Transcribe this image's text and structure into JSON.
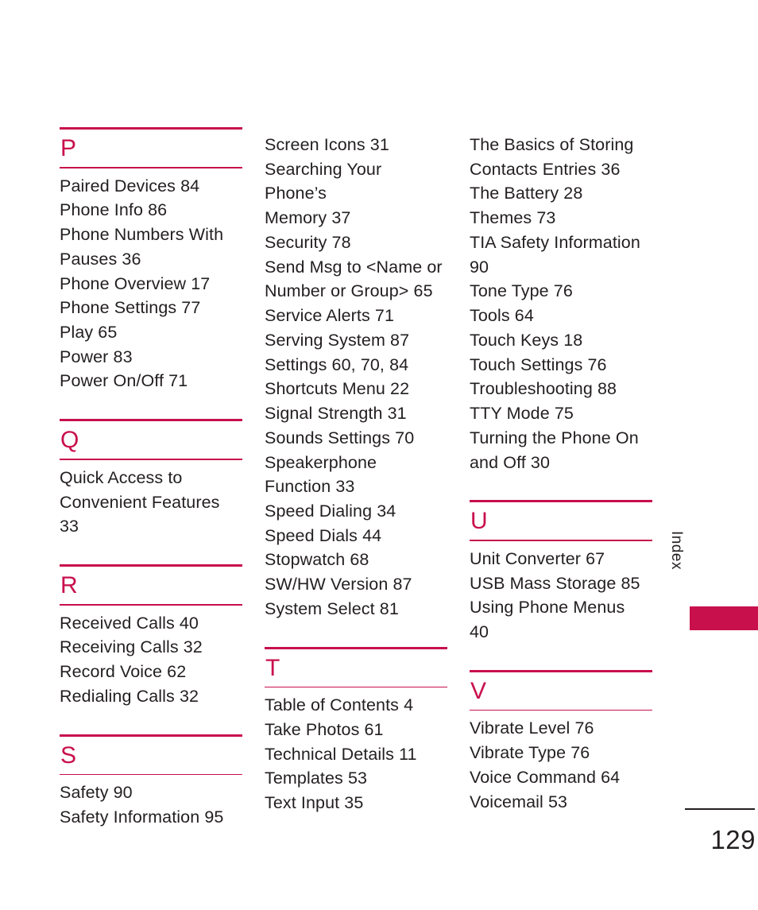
{
  "document": {
    "kind": "printed-manual-index-page",
    "page_number": "129",
    "side_tab_label": "Index",
    "accent_color": "#c8104c",
    "text_color": "#231f20",
    "background_color": "#ffffff"
  },
  "columns": [
    {
      "id": "column-1",
      "sections": [
        {
          "letter": "P",
          "has_heading": true,
          "entries": [
            "Paired Devices 84",
            "Phone Info 86",
            "Phone Numbers With\nPauses 36",
            "Phone Overview 17",
            "Phone Settings 77",
            "Play 65",
            "Power 83",
            "Power On/Off 71"
          ]
        },
        {
          "letter": "Q",
          "has_heading": true,
          "entries": [
            "Quick Access to\nConvenient Features\n33"
          ]
        },
        {
          "letter": "R",
          "has_heading": true,
          "entries": [
            "Received Calls 40",
            "Receiving Calls 32",
            "Record Voice 62",
            "Redialing Calls 32"
          ]
        },
        {
          "letter": "S",
          "has_heading": true,
          "entries": [
            "Safety 90",
            "Safety Information 95"
          ]
        }
      ]
    },
    {
      "id": "column-2",
      "sections": [
        {
          "letter": "",
          "has_heading": false,
          "entries": [
            "Screen Icons 31",
            "Searching Your Phone’s\nMemory 37",
            "Security 78",
            "Send Msg to <Name or\nNumber or Group> 65",
            "Service Alerts 71",
            "Serving System 87",
            "Settings 60, 70, 84",
            "Shortcuts Menu 22",
            "Signal Strength 31",
            "Sounds Settings 70",
            "Speakerphone\nFunction 33",
            "Speed Dialing 34",
            "Speed Dials 44",
            "Stopwatch 68",
            "SW/HW Version 87",
            "System Select 81"
          ]
        },
        {
          "letter": "T",
          "has_heading": true,
          "entries": [
            "Table of Contents 4",
            "Take Photos 61",
            "Technical Details 11",
            "Templates 53",
            "Text Input 35"
          ]
        }
      ]
    },
    {
      "id": "column-3",
      "sections": [
        {
          "letter": "",
          "has_heading": false,
          "entries": [
            "The Basics of Storing\nContacts Entries 36",
            "The Battery 28",
            "Themes 73",
            "TIA Safety Information\n90",
            "Tone Type 76",
            "Tools 64",
            "Touch Keys 18",
            "Touch Settings 76",
            "Troubleshooting 88",
            "TTY Mode 75",
            "Turning the Phone On\nand Off 30"
          ]
        },
        {
          "letter": "U",
          "has_heading": true,
          "entries": [
            "Unit Converter 67",
            "USB Mass Storage 85",
            "Using Phone Menus\n40"
          ]
        },
        {
          "letter": "V",
          "has_heading": true,
          "entries": [
            "Vibrate Level 76",
            "Vibrate Type 76",
            "Voice Command 64",
            "Voicemail 53"
          ]
        }
      ]
    }
  ]
}
